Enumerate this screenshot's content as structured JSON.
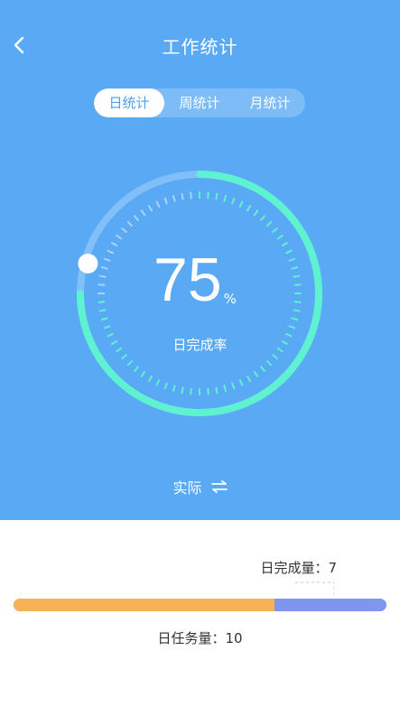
{
  "header": {
    "title": "工作统计"
  },
  "tabs": [
    {
      "label": "日统计",
      "active": true
    },
    {
      "label": "周统计",
      "active": false
    },
    {
      "label": "月统计",
      "active": false
    }
  ],
  "dial": {
    "value": "75",
    "unit": "%",
    "progress": 0.75,
    "label": "日完成率"
  },
  "switch": {
    "label": "实际"
  },
  "summary": {
    "done_label": "日完成量：7",
    "done": 7,
    "task_label": "日任务量：10",
    "total": 10
  },
  "colors": {
    "header_bg": "#5aa9f5",
    "ring_progress": "#5ef2d0",
    "bar_done": "#f7b257",
    "bar_remaining": "#7f96ee"
  },
  "icons": {
    "back": "chevron-left-icon",
    "switch": "swap-arrows-icon"
  }
}
